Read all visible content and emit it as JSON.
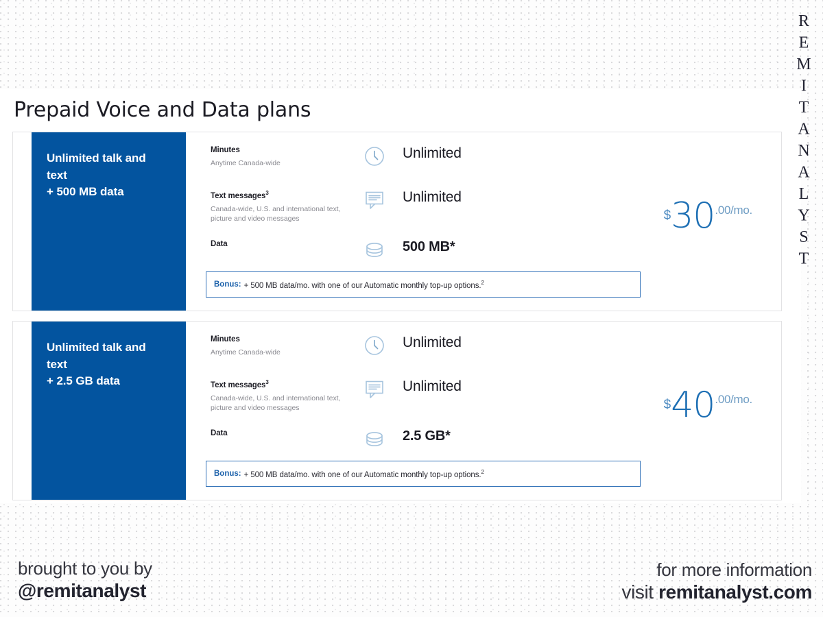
{
  "brand": {
    "vertical_wordmark": "REMITANALYST"
  },
  "heading": {
    "title": "Prepaid Voice and Data plans"
  },
  "plans": [
    {
      "banner": "Unlimited talk and text\n+ 500 MB data",
      "banner_line1": "Unlimited talk and",
      "banner_line2": "text",
      "banner_line3": "+ 500 MB data",
      "features": [
        {
          "label": "Minutes",
          "superscript": "",
          "sublabel": "Anytime Canada-wide",
          "icon": "clock-icon",
          "value": "Unlimited",
          "bold": false
        },
        {
          "label": "Text messages",
          "superscript": "3",
          "sublabel": "Canada-wide, U.S. and international text, picture and video messages",
          "icon": "chat-bubble-icon",
          "value": "Unlimited",
          "bold": false
        },
        {
          "label": "Data",
          "superscript": "",
          "sublabel": "",
          "icon": "database-icon",
          "value": "500 MB*",
          "bold": true
        }
      ],
      "bonus": {
        "label": "Bonus:",
        "text": "+ 500 MB data/mo. with one of our Automatic monthly top-up options.",
        "superscript": "2"
      },
      "price": {
        "currency": "$",
        "amount": "30",
        "suffix": ".00/mo."
      }
    },
    {
      "banner": "Unlimited talk and text\n+ 2.5 GB data",
      "banner_line1": "Unlimited talk and",
      "banner_line2": "text",
      "banner_line3": "+ 2.5 GB data",
      "features": [
        {
          "label": "Minutes",
          "superscript": "",
          "sublabel": "Anytime Canada-wide",
          "icon": "clock-icon",
          "value": "Unlimited",
          "bold": false
        },
        {
          "label": "Text messages",
          "superscript": "3",
          "sublabel": "Canada-wide, U.S. and international text, picture and video messages",
          "icon": "chat-bubble-icon",
          "value": "Unlimited",
          "bold": false
        },
        {
          "label": "Data",
          "superscript": "",
          "sublabel": "",
          "icon": "database-icon",
          "value": "2.5 GB*",
          "bold": true
        }
      ],
      "bonus": {
        "label": "Bonus:",
        "text": "+ 500 MB data/mo. with one of our Automatic monthly top-up options.",
        "superscript": "2"
      },
      "price": {
        "currency": "$",
        "amount": "40",
        "suffix": ".00/mo."
      }
    }
  ],
  "footer": {
    "left_line1": "brought to you by",
    "left_line2": "@remitanalyst",
    "right_line1": "for more information",
    "right_line2_thin": "visit ",
    "right_line2_bold": "remitanalyst.com"
  },
  "colors": {
    "banner_blue": "#03549F",
    "price_blue": "#1D6FB4",
    "bonus_border": "#2E6FB7",
    "bonus_label": "#1D62AB",
    "icon_blue": "#9FC0DC",
    "sublabel_grey": "#8B8B92"
  }
}
